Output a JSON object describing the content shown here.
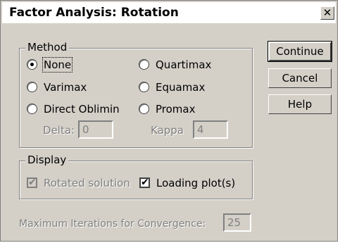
{
  "window": {
    "title": "Factor Analysis: Rotation",
    "close_glyph": "✕"
  },
  "method": {
    "legend": "Method",
    "options": [
      {
        "label": "None",
        "selected": true
      },
      {
        "label": "Varimax",
        "selected": false
      },
      {
        "label": "Direct Oblimin",
        "selected": false
      },
      {
        "label": "Quartimax",
        "selected": false
      },
      {
        "label": "Equamax",
        "selected": false
      },
      {
        "label": "Promax",
        "selected": false
      }
    ],
    "delta_label": "Delta:",
    "delta_value": "0",
    "kappa_label": "Kappa",
    "kappa_value": "4"
  },
  "display": {
    "legend": "Display",
    "rotated_solution": {
      "label": "Rotated solution",
      "checked": true,
      "enabled": false
    },
    "loading_plots": {
      "label": "Loading plot(s)",
      "checked": true,
      "enabled": true
    }
  },
  "iterations": {
    "label": "Maximum Iterations for Convergence:",
    "value": "25"
  },
  "buttons": {
    "continue": "Continue",
    "cancel": "Cancel",
    "help": "Help"
  },
  "check_glyph": "✔"
}
